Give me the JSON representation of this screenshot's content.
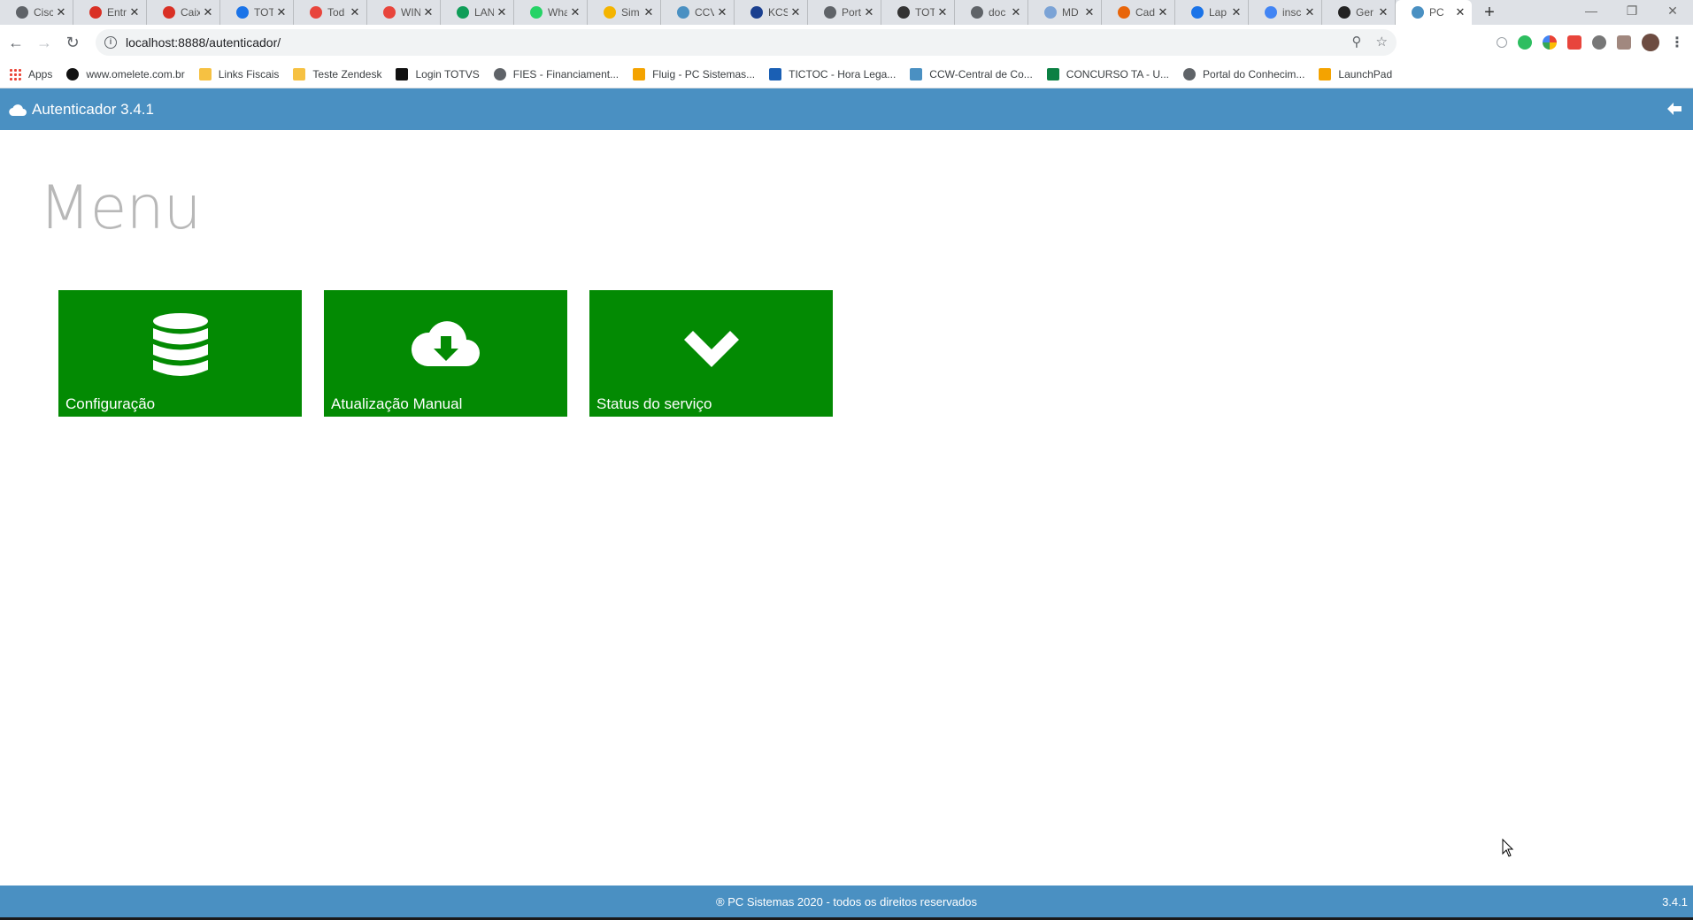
{
  "browser": {
    "tabs": [
      {
        "title": "Cisc",
        "icon": "globe-icon",
        "color": "#5f6368"
      },
      {
        "title": "Entr",
        "icon": "gmail-icon",
        "color": "#d93025"
      },
      {
        "title": "Caix",
        "icon": "gmail-icon",
        "color": "#d93025"
      },
      {
        "title": "TOT",
        "icon": "circle-icon",
        "color": "#1a73e8"
      },
      {
        "title": "Tod",
        "icon": "triangle-icon",
        "color": "#e8453c"
      },
      {
        "title": "WIN",
        "icon": "triangle-icon",
        "color": "#e8453c"
      },
      {
        "title": "LAN",
        "icon": "sheet-icon",
        "color": "#0f9d58"
      },
      {
        "title": "Wha",
        "icon": "whatsapp-icon",
        "color": "#25d366"
      },
      {
        "title": "Sim",
        "icon": "coin-icon",
        "color": "#f4b400"
      },
      {
        "title": "CCV",
        "icon": "pc-icon",
        "color": "#4a90c2"
      },
      {
        "title": "KCS",
        "icon": "kcs-icon",
        "color": "#1a3f8f"
      },
      {
        "title": "Port",
        "icon": "globe-icon",
        "color": "#5f6368"
      },
      {
        "title": "TOT",
        "icon": "circle-icon",
        "color": "#333333"
      },
      {
        "title": "doc",
        "icon": "globe-icon",
        "color": "#5f6368"
      },
      {
        "title": "MD",
        "icon": "md-icon",
        "color": "#7ba3d6"
      },
      {
        "title": "Cad",
        "icon": "m-icon",
        "color": "#e8650a"
      },
      {
        "title": "Lap",
        "icon": "lap-icon",
        "color": "#1a73e8"
      },
      {
        "title": "insc",
        "icon": "google-icon",
        "color": "#4285f4"
      },
      {
        "title": "Ger",
        "icon": "md-bold-icon",
        "color": "#222222"
      },
      {
        "title": "PC",
        "icon": "pc-icon",
        "color": "#4a90c2"
      }
    ],
    "new_tab": "+",
    "url": "localhost:8888/autenticador/",
    "bookmarks": [
      {
        "label": "Apps",
        "icon": "apps-grid-icon",
        "color": "#ea4335"
      },
      {
        "label": "www.omelete.com.br",
        "icon": "omelete-icon",
        "color": "#111111"
      },
      {
        "label": "Links Fiscais",
        "icon": "folder-icon",
        "color": "#f6c142"
      },
      {
        "label": "Teste Zendesk",
        "icon": "folder-icon",
        "color": "#f6c142"
      },
      {
        "label": "Login TOTVS",
        "icon": "totvs-icon",
        "color": "#111111"
      },
      {
        "label": "FIES - Financiament...",
        "icon": "globe-icon",
        "color": "#5f6368"
      },
      {
        "label": "Fluig - PC Sistemas...",
        "icon": "fluig-icon",
        "color": "#f4a300"
      },
      {
        "label": "TICTOC - Hora Lega...",
        "icon": "tictoc-icon",
        "color": "#1a5fb4"
      },
      {
        "label": "CCW-Central de Co...",
        "icon": "pc-icon",
        "color": "#4a90c2"
      },
      {
        "label": "CONCURSO TA - U...",
        "icon": "concurso-icon",
        "color": "#0b8043"
      },
      {
        "label": "Portal do Conhecim...",
        "icon": "globe-icon",
        "color": "#5f6368"
      },
      {
        "label": "LaunchPad",
        "icon": "fluig-icon",
        "color": "#f4a300"
      }
    ]
  },
  "app": {
    "brand": "Autenticador 3.4.1",
    "title": "Menu",
    "tiles": [
      {
        "label": "Configuração",
        "icon": "database-icon"
      },
      {
        "label": "Atualização Manual",
        "icon": "cloud-download-icon"
      },
      {
        "label": "Status do serviço",
        "icon": "chevron-down-icon"
      }
    ],
    "tile_color": "#038a03",
    "bar_color": "#4a90c2",
    "footer": "® PC Sistemas 2020 - todos os direitos reservados",
    "footer_version": "3.4.1"
  }
}
